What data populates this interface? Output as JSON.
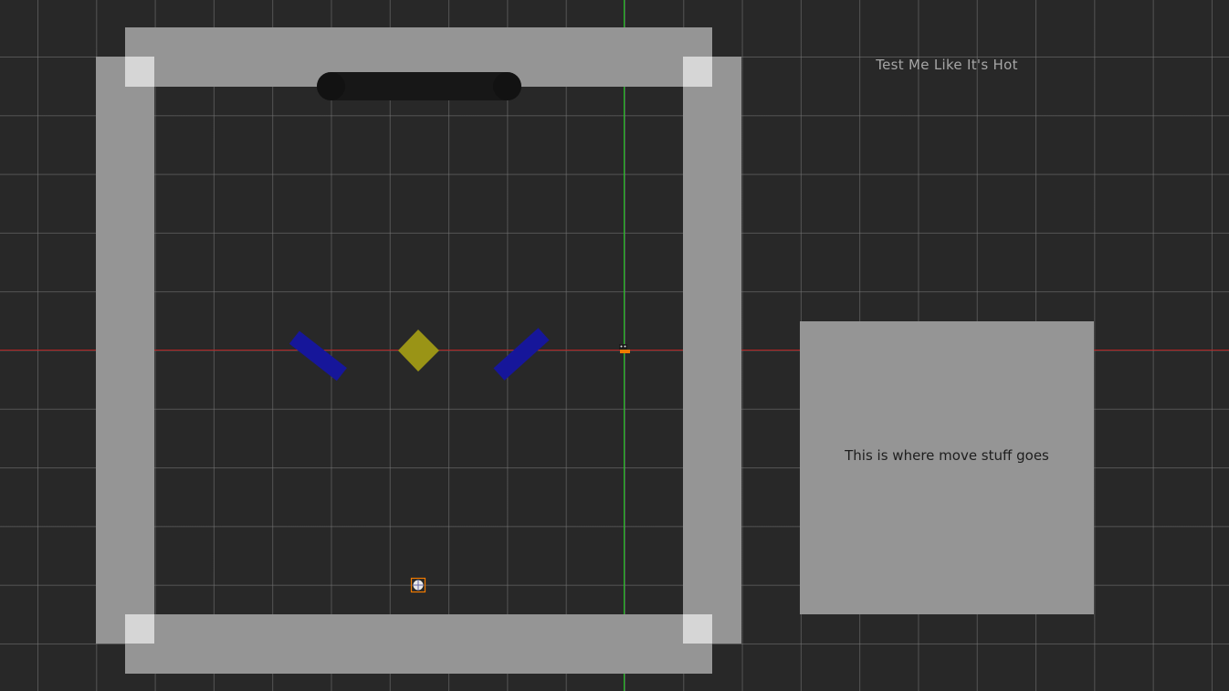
{
  "scene": {
    "title": "Test Me Like It's Hot",
    "move_panel_text": "This is where move stuff goes"
  },
  "colors": {
    "background": "#282828",
    "grid_line": "#787878",
    "x_axis": "#b52222",
    "y_axis": "#19c419",
    "wall": "#959595",
    "wall_corner": "#d6d6d6",
    "flipper": "#16169a",
    "diamond": "#9a9416",
    "capsule": "#171717",
    "panel": "#959595",
    "player_marker": "#f07a00"
  },
  "icons": {
    "paddle": "capsule-shape",
    "left_flipper": "blue-bar",
    "right_flipper": "blue-bar",
    "center_bumper": "diamond-shape",
    "ball_spawn": "crosshair-icon",
    "player": "character-icon"
  }
}
